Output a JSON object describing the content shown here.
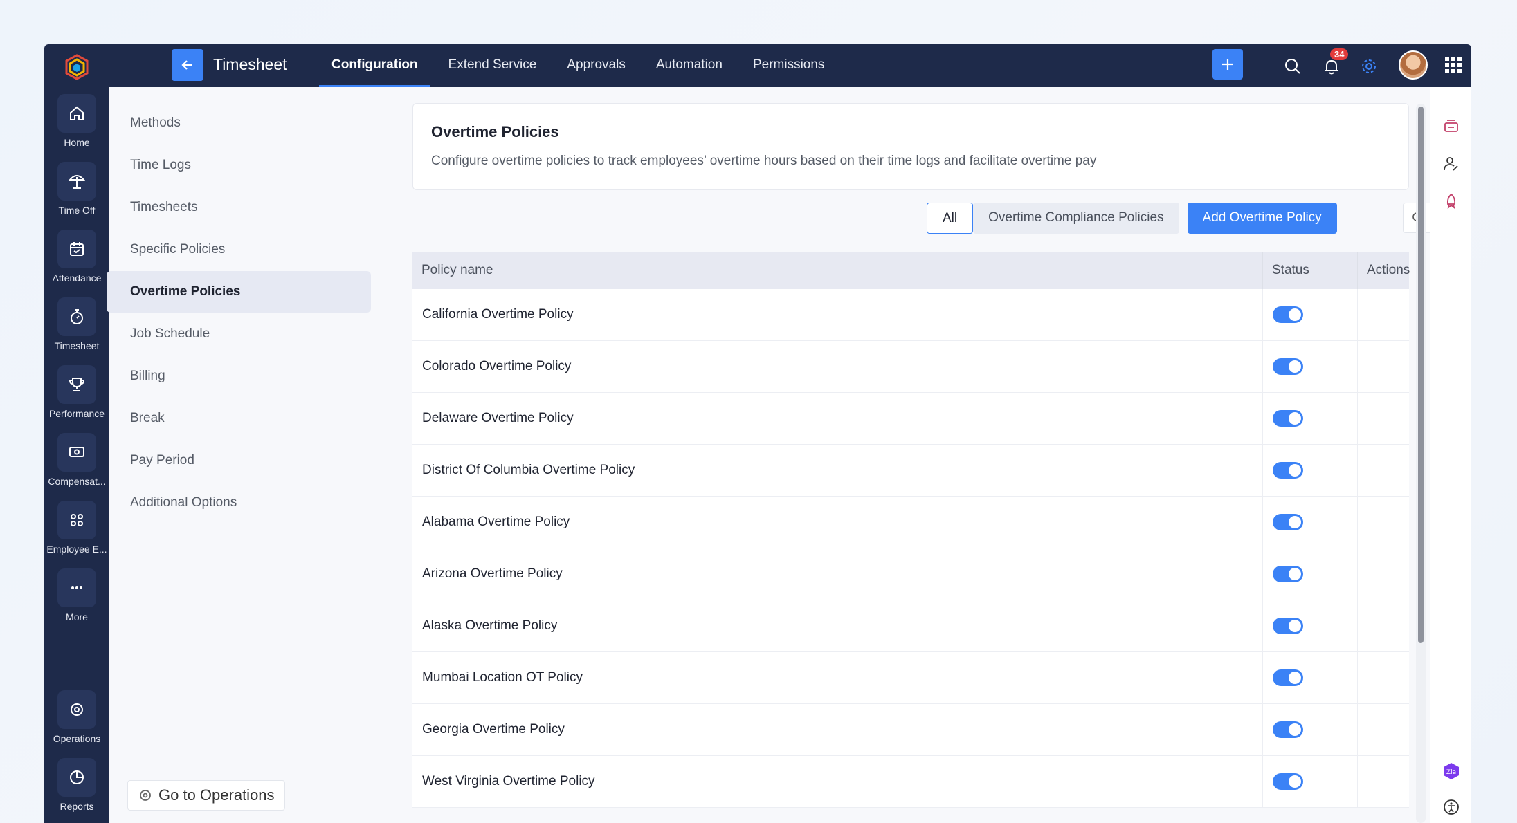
{
  "topbar": {
    "app_title": "Timesheet",
    "tabs": [
      {
        "label": "Configuration",
        "active": true
      },
      {
        "label": "Extend Service"
      },
      {
        "label": "Approvals"
      },
      {
        "label": "Automation"
      },
      {
        "label": "Permissions"
      }
    ],
    "notification_count": "34"
  },
  "rail": {
    "items": [
      {
        "label": "Home",
        "icon": "home-icon"
      },
      {
        "label": "Time Off",
        "icon": "beach-umbrella-icon"
      },
      {
        "label": "Attendance",
        "icon": "calendar-check-icon"
      },
      {
        "label": "Timesheet",
        "icon": "stopwatch-icon"
      },
      {
        "label": "Performance",
        "icon": "trophy-icon"
      },
      {
        "label": "Compensat...",
        "icon": "compensation-icon"
      },
      {
        "label": "Employee E...",
        "icon": "employee-engagement-icon"
      },
      {
        "label": "More",
        "icon": "more-icon"
      },
      {
        "label": "Operations",
        "icon": "operations-icon"
      },
      {
        "label": "Reports",
        "icon": "pie-chart-icon"
      }
    ]
  },
  "subnav": {
    "items": [
      {
        "label": "Methods"
      },
      {
        "label": "Time Logs"
      },
      {
        "label": "Timesheets"
      },
      {
        "label": "Specific Policies"
      },
      {
        "label": "Overtime Policies",
        "active": true
      },
      {
        "label": "Job Schedule"
      },
      {
        "label": "Billing"
      },
      {
        "label": "Break"
      },
      {
        "label": "Pay Period"
      },
      {
        "label": "Additional Options"
      }
    ],
    "goto_ops": "Go to Operations"
  },
  "card": {
    "title": "Overtime Policies",
    "description": "Configure overtime policies to track employees’ overtime hours based on their time logs and facilitate overtime pay"
  },
  "filters": {
    "all": "All",
    "compliance": "Overtime Compliance Policies",
    "add": "Add Overtime Policy"
  },
  "table": {
    "headers": {
      "name": "Policy name",
      "status": "Status",
      "actions": "Actions"
    },
    "rows": [
      {
        "name": "California Overtime Policy",
        "enabled": true
      },
      {
        "name": "Colorado Overtime Policy",
        "enabled": true
      },
      {
        "name": "Delaware Overtime Policy",
        "enabled": true
      },
      {
        "name": "District Of Columbia Overtime Policy",
        "enabled": true
      },
      {
        "name": "Alabama Overtime Policy",
        "enabled": true
      },
      {
        "name": "Arizona Overtime Policy",
        "enabled": true
      },
      {
        "name": "Alaska Overtime Policy",
        "enabled": true
      },
      {
        "name": "Mumbai Location OT Policy",
        "enabled": true
      },
      {
        "name": "Georgia Overtime Policy",
        "enabled": true
      },
      {
        "name": "West Virginia Overtime Policy",
        "enabled": true
      }
    ]
  },
  "colors": {
    "accent": "#3b82f6",
    "nav_bg": "#1e2a4a",
    "badge": "#e23b3b"
  }
}
